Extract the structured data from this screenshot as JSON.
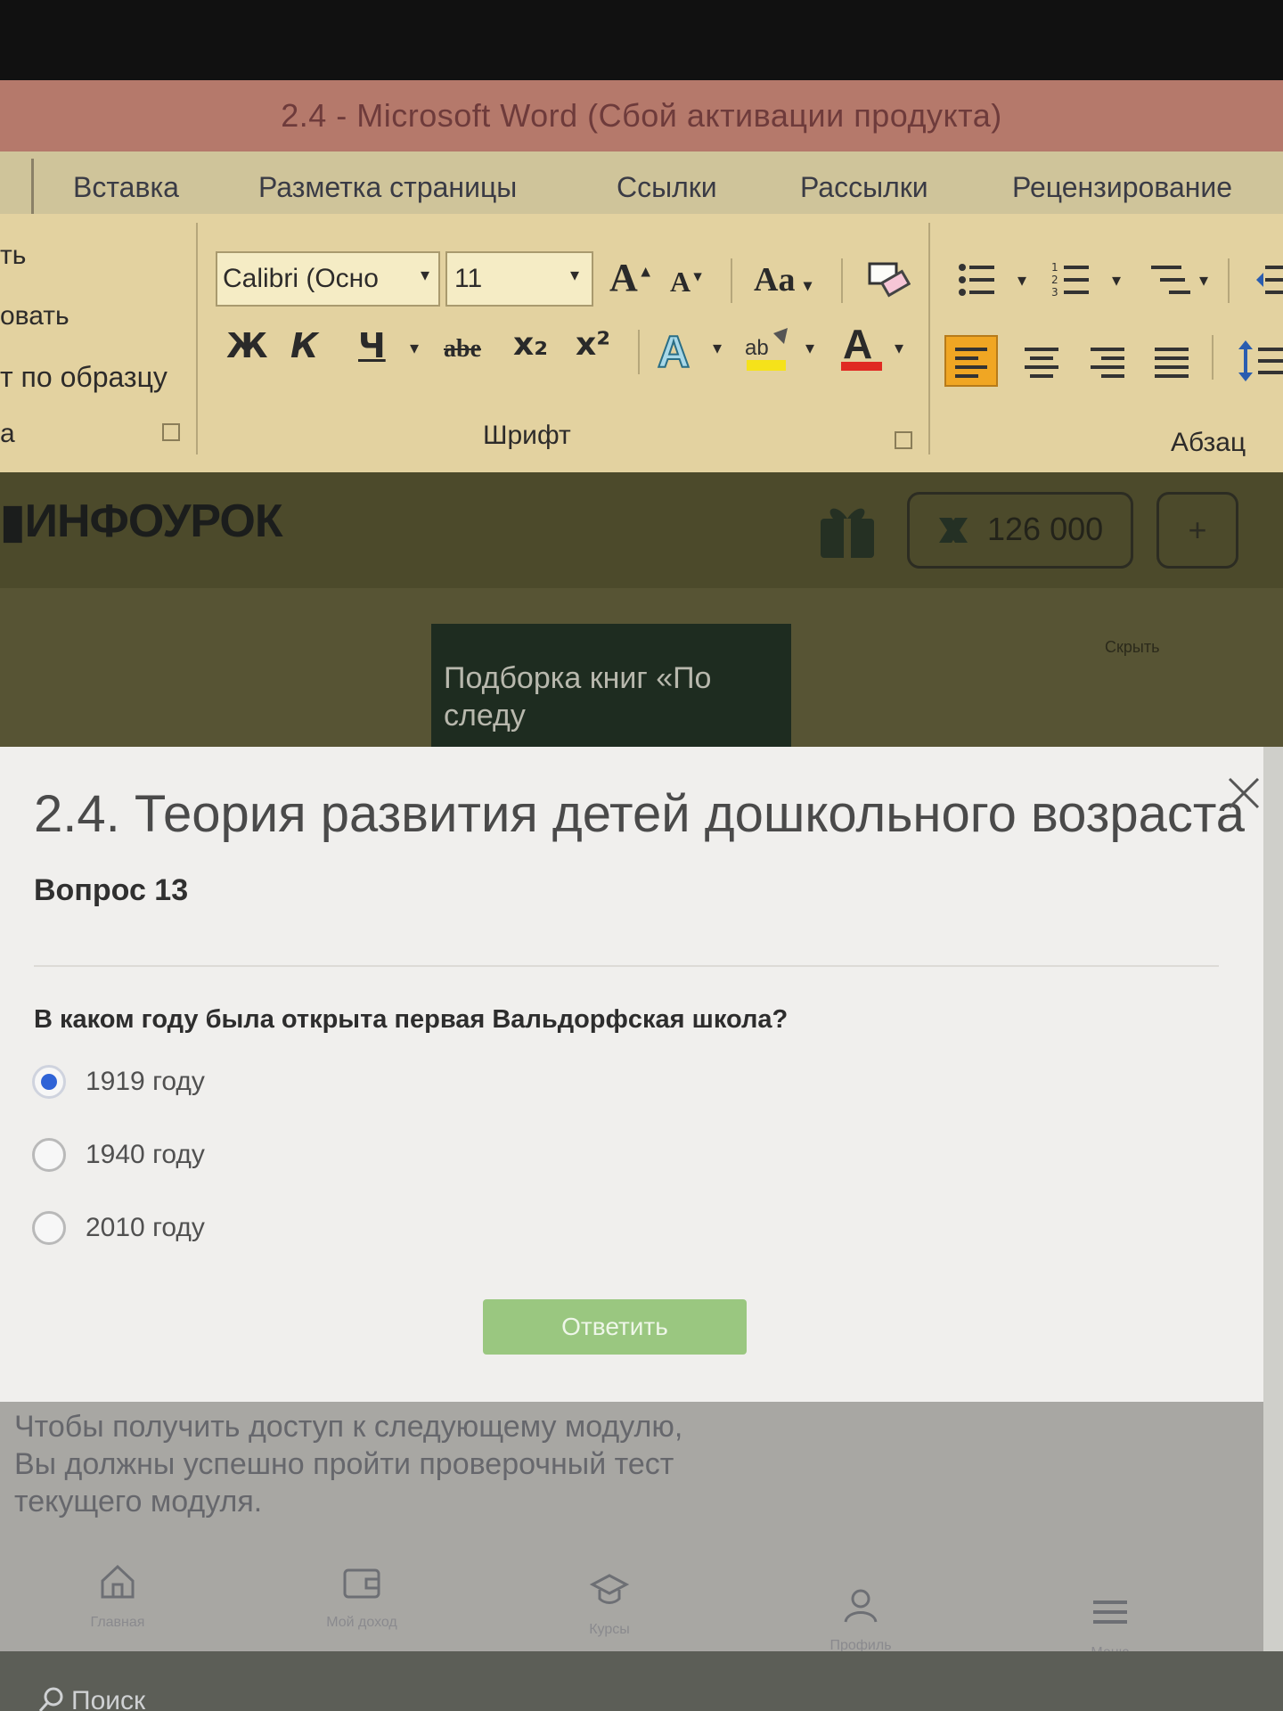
{
  "word": {
    "title": "2.4 - Microsoft Word (Сбой активации продукта)",
    "tabs": [
      "Вставка",
      "Разметка страницы",
      "Ссылки",
      "Рассылки",
      "Рецензирование"
    ],
    "clipboard": {
      "lines": [
        "ть",
        "овать",
        "т по образцу"
      ],
      "group_label": "а"
    },
    "font": {
      "name": "Calibri (Осно",
      "size": "11",
      "group_label": "Шрифт",
      "bold": "Ж",
      "italic": "К",
      "underline": "Ч",
      "strike": "abe",
      "subscript": "x₂",
      "superscript": "x²",
      "grow": "A",
      "shrink": "A",
      "case": "Aa"
    },
    "paragraph": {
      "group_label": "Абзац"
    }
  },
  "site": {
    "logo": "ИНФОУРОК",
    "balance": "126 000",
    "plus": "+",
    "promo": "Подборка книг «По следу",
    "hide": "Скрыть"
  },
  "quiz": {
    "title": "2.4. Теория развития детей дошкольного возраста",
    "question_number": "Вопрос 13",
    "question": "В каком году была открыта первая Вальдорфская школа?",
    "options": [
      {
        "label": "1919 году",
        "selected": true
      },
      {
        "label": "1940 году",
        "selected": false
      },
      {
        "label": "2010 году",
        "selected": false
      }
    ],
    "submit": "Ответить"
  },
  "notice": "Чтобы получить доступ к следующему модулю, Вы должны успешно пройти проверочный тест текущего модуля.",
  "bottom_nav": [
    {
      "label": "Главная",
      "icon": "home-icon"
    },
    {
      "label": "Мой доход",
      "icon": "wallet-icon"
    },
    {
      "label": "Курсы",
      "icon": "graduation-cap-icon"
    },
    {
      "label": "Профиль",
      "icon": "profile-icon"
    },
    {
      "label": "Меню",
      "icon": "menu-icon"
    }
  ],
  "taskbar": {
    "search": "Поиск"
  },
  "colors": {
    "word_title_bar": "#b5796b",
    "ribbon": "#e3d2a0",
    "site_header": "#4c4a2b",
    "radio_selected": "#2f63d6",
    "answer_button": "#9ac780"
  }
}
